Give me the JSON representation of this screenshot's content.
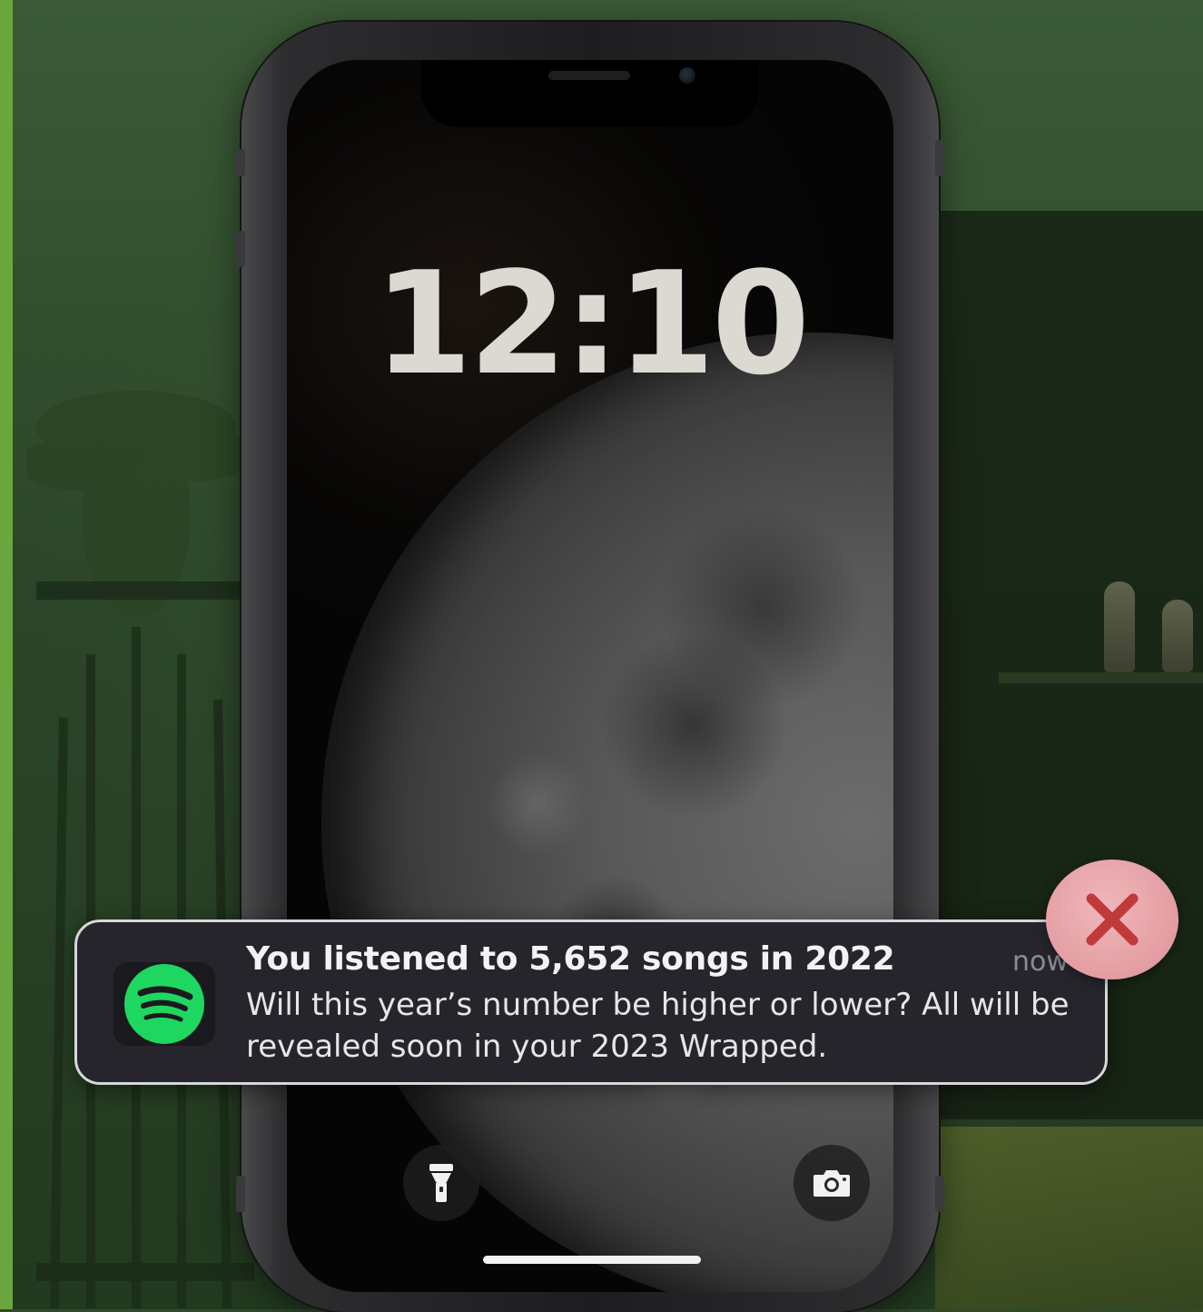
{
  "lock_screen": {
    "time": "12:10"
  },
  "notification": {
    "app_icon": "spotify-icon",
    "title": "You listened to 5,652 songs in 2022",
    "timestamp": "now",
    "body": "Will this year’s number be higher or lower? All will be revealed soon in your 2023 Wrapped."
  },
  "quick_actions": {
    "left_icon": "flashlight-icon",
    "right_icon": "camera-icon"
  },
  "overlay": {
    "close_icon": "close-icon"
  },
  "colors": {
    "spotify_green": "#1ed760",
    "close_x": "#c0393b",
    "accent_strip": "#6aa63e"
  }
}
